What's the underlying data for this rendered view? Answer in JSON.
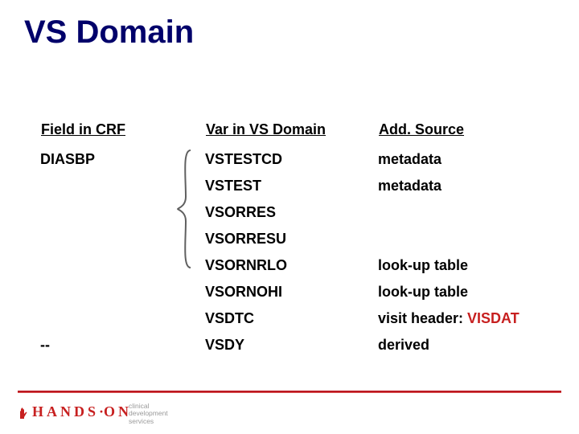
{
  "title": "VS Domain",
  "table": {
    "headers": {
      "col1": "Field in CRF",
      "col2": "Var in VS Domain",
      "col3": "Add. Source"
    },
    "rows": [
      {
        "crf": "DIASBP",
        "var": "VSTESTCD",
        "src": "metadata",
        "src_hl": ""
      },
      {
        "crf": "",
        "var": "VSTEST",
        "src": "metadata",
        "src_hl": ""
      },
      {
        "crf": "",
        "var": "VSORRES",
        "src": "",
        "src_hl": ""
      },
      {
        "crf": "",
        "var": "VSORRESU",
        "src": "",
        "src_hl": ""
      },
      {
        "crf": "",
        "var": "VSORNRLO",
        "src": "look-up table",
        "src_hl": ""
      },
      {
        "crf": "",
        "var": "VSORNOHI",
        "src": "look-up table",
        "src_hl": ""
      },
      {
        "crf": "",
        "var": "VSDTC",
        "src": "visit header: ",
        "src_hl": "VISDAT"
      },
      {
        "crf": "--",
        "var": "VSDY",
        "src": "derived",
        "src_hl": ""
      }
    ]
  },
  "footer": {
    "logo_main": "HANDS",
    "logo_dot": "·",
    "logo_tail": "ON",
    "sub1": "clinical",
    "sub2": "development",
    "sub3": "services"
  }
}
